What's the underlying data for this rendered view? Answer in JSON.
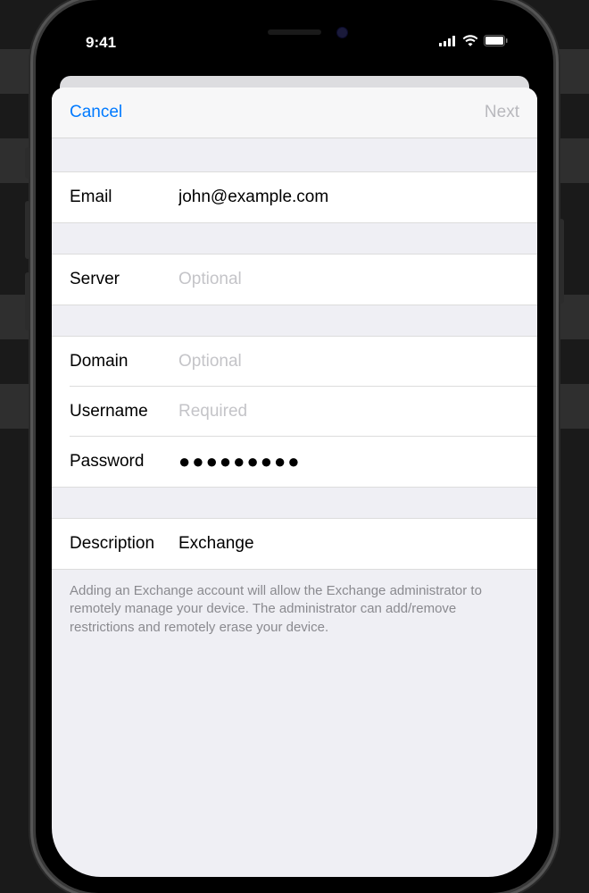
{
  "status": {
    "time": "9:41"
  },
  "nav": {
    "cancel": "Cancel",
    "next": "Next"
  },
  "form": {
    "email": {
      "label": "Email",
      "value": "john@example.com"
    },
    "server": {
      "label": "Server",
      "placeholder": "Optional",
      "value": ""
    },
    "domain": {
      "label": "Domain",
      "placeholder": "Optional",
      "value": ""
    },
    "username": {
      "label": "Username",
      "placeholder": "Required",
      "value": ""
    },
    "password": {
      "label": "Password",
      "value": "●●●●●●●●●"
    },
    "description": {
      "label": "Description",
      "value": "Exchange"
    }
  },
  "footer": "Adding an Exchange account will allow the Exchange administrator to remotely manage your device. The administrator can add/remove restrictions and remotely erase your device."
}
